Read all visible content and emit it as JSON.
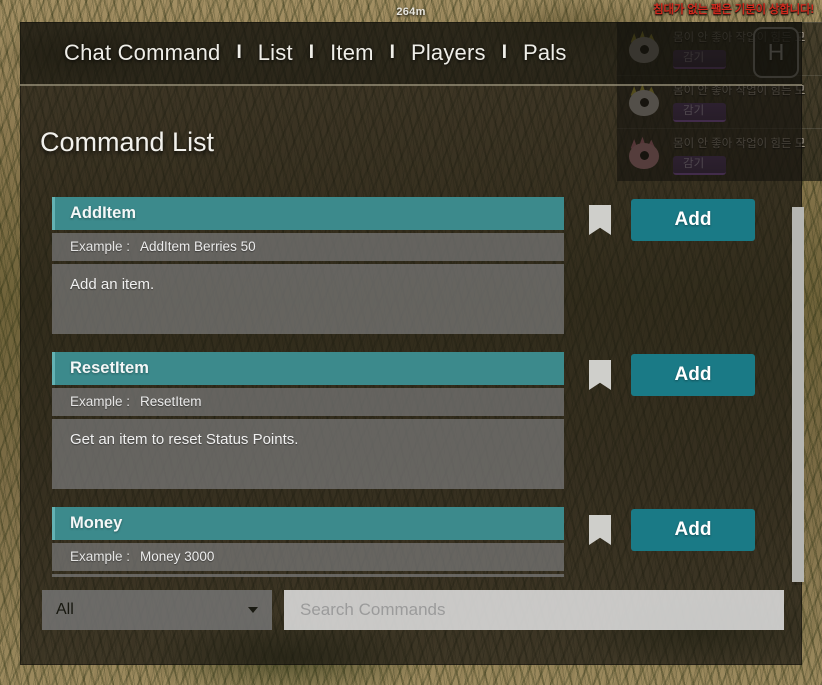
{
  "hud": {
    "distance_marker": "264m",
    "pal_alert": "침대가 없는 팰은 기분이 상합니다!",
    "key_hint": "H",
    "pals": [
      {
        "status": "몸이 안 좋아 작업이 힘든 모",
        "badge": "감기",
        "color": "#dccc3e"
      },
      {
        "status": "몸이 안 좋아 작업이 힘든 모",
        "badge": "감기",
        "color": "#dccc3e"
      },
      {
        "status": "몸이 안 좋아 작업이 힘든 모",
        "badge": "감기",
        "color": "#e07f93"
      }
    ]
  },
  "nav": {
    "items": [
      {
        "label": "Chat Command"
      },
      {
        "label": "List"
      },
      {
        "label": "Item"
      },
      {
        "label": "Players"
      },
      {
        "label": "Pals"
      }
    ],
    "separator": "I"
  },
  "panel": {
    "title": "Command List",
    "example_label": "Example :",
    "add_label": "Add",
    "bookmark_icon": "bookmark-icon"
  },
  "commands": [
    {
      "name": "AddItem",
      "example": "AddItem Berries 50",
      "description": "Add an item."
    },
    {
      "name": "ResetItem",
      "example": "ResetItem",
      "description": "Get an item to reset Status Points."
    },
    {
      "name": "Money",
      "example": "Money 3000",
      "description": ""
    }
  ],
  "toolbar": {
    "filter_value": "All",
    "search_placeholder": "Search Commands",
    "search_value": ""
  },
  "colors": {
    "accent_teal": "#3c8a8c",
    "button_teal": "#1a7a86",
    "alert_red": "#cf2b1e",
    "badge_purple": "#a661d6"
  }
}
